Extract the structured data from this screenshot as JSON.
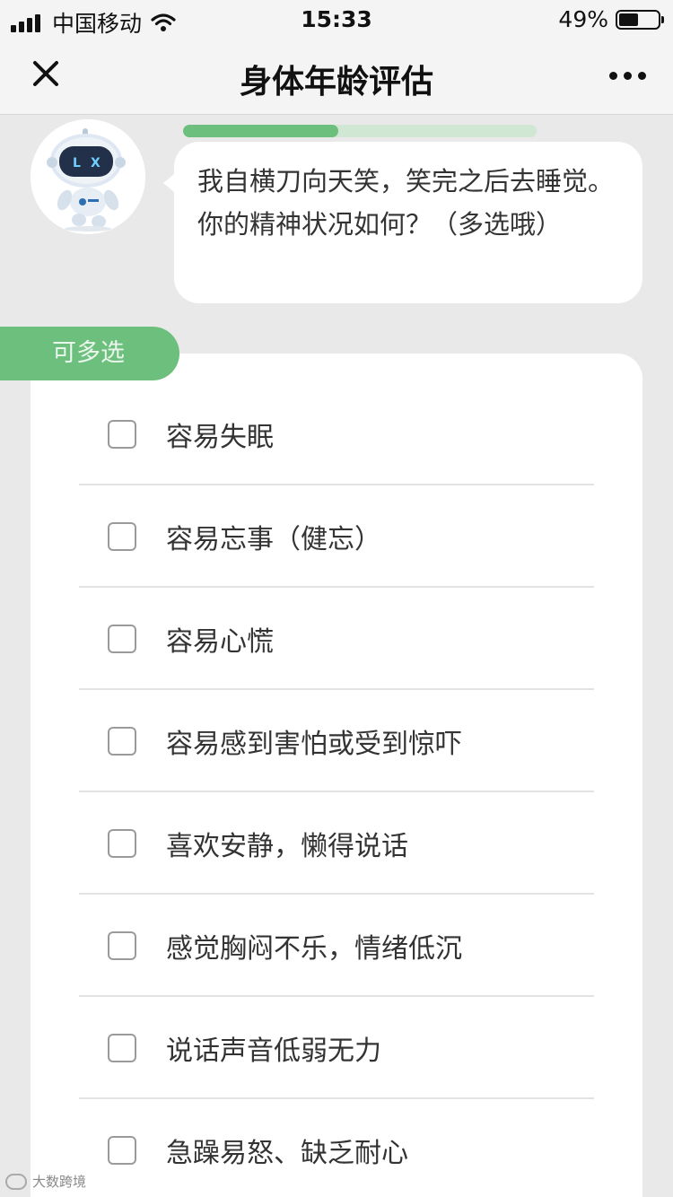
{
  "status_bar": {
    "carrier": "中国移动",
    "time": "15:33",
    "battery": "49%",
    "battery_level": 0.49
  },
  "nav": {
    "title": "身体年龄评估",
    "close_icon": "close-icon",
    "more_icon": "more-dots-icon"
  },
  "progress": {
    "fraction": 0.44
  },
  "question": {
    "text": "我自横刀向天笑，笑完之后去睡觉。你的精神状况如何？（多选哦）"
  },
  "multi_tag": "可多选",
  "options": [
    {
      "label": "容易失眠",
      "checked": false
    },
    {
      "label": "容易忘事（健忘）",
      "checked": false
    },
    {
      "label": "容易心慌",
      "checked": false
    },
    {
      "label": "容易感到害怕或受到惊吓",
      "checked": false
    },
    {
      "label": "喜欢安静，懒得说话",
      "checked": false
    },
    {
      "label": "感觉胸闷不乐，情绪低沉",
      "checked": false
    },
    {
      "label": "说话声音低弱无力",
      "checked": false
    },
    {
      "label": "急躁易怒、缺乏耐心",
      "checked": false
    }
  ],
  "watermark": "大数跨境",
  "colors": {
    "accent_green": "#6cbf7c",
    "progress_track": "#cfe7d3",
    "background": "#e9e9ea"
  }
}
